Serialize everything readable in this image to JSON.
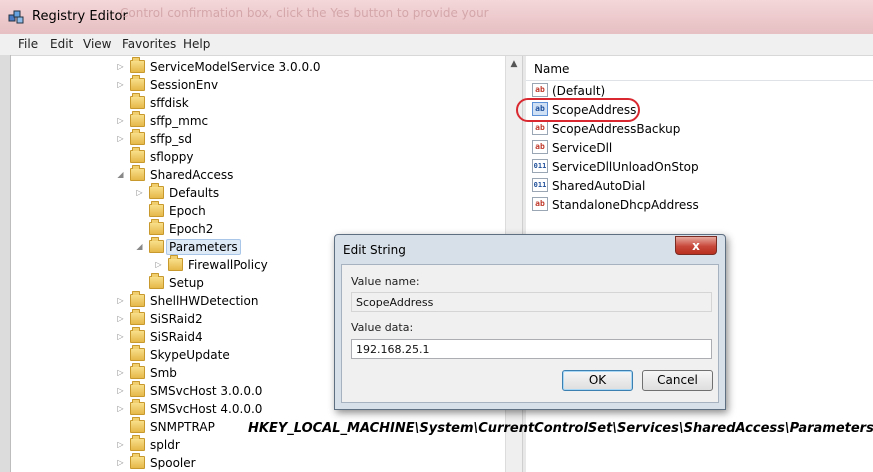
{
  "window": {
    "title": "Registry Editor",
    "background_text": "Control confirmation box, click the Yes button to provide your"
  },
  "menu": [
    "File",
    "Edit",
    "View",
    "Favorites",
    "Help"
  ],
  "tree": [
    {
      "label": "ServiceModelService 3.0.0.0"
    },
    {
      "label": "SessionEnv"
    },
    {
      "label": "sffdisk"
    },
    {
      "label": "sffp_mmc"
    },
    {
      "label": "sffp_sd"
    },
    {
      "label": "sfloppy"
    },
    {
      "label": "SharedAccess"
    },
    {
      "label": "Defaults"
    },
    {
      "label": "Epoch"
    },
    {
      "label": "Epoch2"
    },
    {
      "label": "Parameters"
    },
    {
      "label": "FirewallPolicy"
    },
    {
      "label": "Setup"
    },
    {
      "label": "ShellHWDetection"
    },
    {
      "label": "SiSRaid2"
    },
    {
      "label": "SiSRaid4"
    },
    {
      "label": "SkypeUpdate"
    },
    {
      "label": "Smb"
    },
    {
      "label": "SMSvcHost 3.0.0.0"
    },
    {
      "label": "SMSvcHost 4.0.0.0"
    },
    {
      "label": "SNMPTRAP"
    },
    {
      "label": "spldr"
    },
    {
      "label": "Spooler"
    }
  ],
  "values_pane": {
    "column_name": "Name",
    "items": [
      {
        "label": "(Default)",
        "icon": "string-value-icon"
      },
      {
        "label": "ScopeAddress",
        "icon": "string-value-icon"
      },
      {
        "label": "ScopeAddressBackup",
        "icon": "string-value-icon"
      },
      {
        "label": "ServiceDll",
        "icon": "string-value-icon"
      },
      {
        "label": "ServiceDllUnloadOnStop",
        "icon": "binary-value-icon"
      },
      {
        "label": "SharedAutoDial",
        "icon": "binary-value-icon"
      },
      {
        "label": "StandaloneDhcpAddress",
        "icon": "string-value-icon"
      }
    ]
  },
  "dialog": {
    "title": "Edit String",
    "close_label": "x",
    "value_name_label": "Value name:",
    "value_name": "ScopeAddress",
    "value_data_label": "Value data:",
    "value_data": "192.168.25.1",
    "ok_label": "OK",
    "cancel_label": "Cancel"
  },
  "caption": "HKEY_LOCAL_MACHINE\\System\\CurrentControlSet\\Services\\SharedAccess\\Parameters.",
  "icon_glyphs": {
    "string": "ab",
    "binary": "011"
  },
  "colors": {
    "title_bar": "#ecc8cb",
    "annotation_circle": "#d9282f",
    "close_button": "#c7483a"
  }
}
